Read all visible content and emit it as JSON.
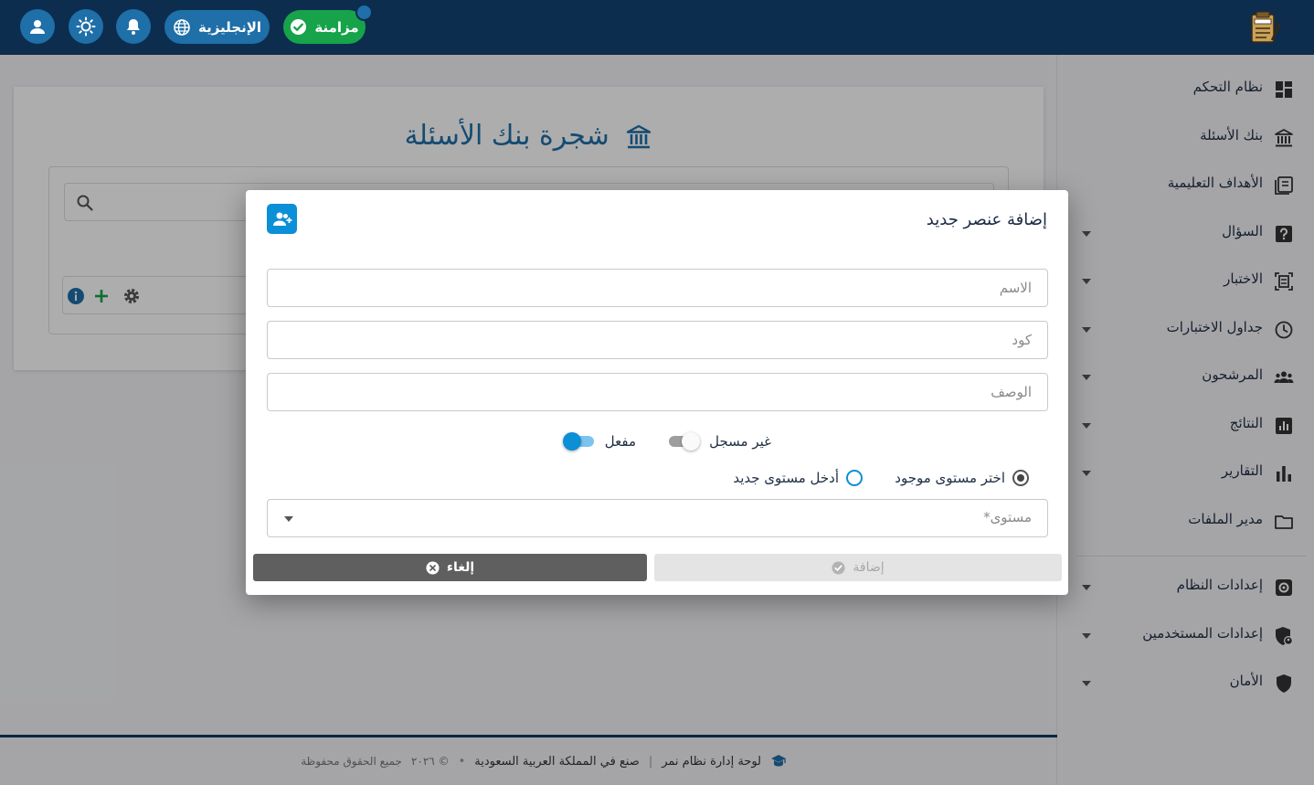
{
  "topbar": {
    "language_label": "الإنجليزية",
    "sync_label": "مزامنة"
  },
  "sidebar": {
    "items": [
      {
        "label": "نظام التحكم"
      },
      {
        "label": "بنك الأسئلة"
      },
      {
        "label": "الأهداف التعليمية"
      },
      {
        "label": "السؤال"
      },
      {
        "label": "الاختبار"
      },
      {
        "label": "جداول الاختبارات"
      },
      {
        "label": "المرشحون"
      },
      {
        "label": "النتائج"
      },
      {
        "label": "التقارير"
      },
      {
        "label": "مدير الملفات"
      },
      {
        "label": "إعدادات النظام"
      },
      {
        "label": "إعدادات المستخدمين"
      },
      {
        "label": "الأمان"
      }
    ]
  },
  "main": {
    "title": "شجرة بنك الأسئلة"
  },
  "dialog": {
    "title": "إضافة عنصر جديد",
    "name_placeholder": "الاسم",
    "code_placeholder": "كود",
    "description_placeholder": "الوصف",
    "toggle_unregistered_label": "غير مسجل",
    "toggle_unregistered_on": false,
    "toggle_enabled_label": "مفعل",
    "toggle_enabled_on": true,
    "radio_existing_label": "اختر مستوى موجود",
    "radio_new_label": "أدخل مستوى جديد",
    "selected_radio": "existing",
    "level_select_label": "مستوى*",
    "add_button": "إضافة",
    "cancel_button": "إلغاء"
  },
  "footer": {
    "brand": "لوحة إدارة نظام نمر",
    "made_in": "صنع في المملكة العربية السعودية",
    "rights": "جميع الحقوق محفوظة",
    "copyright": "© ٢٠٢٦"
  },
  "colors": {
    "topbar": "#0d2d4e",
    "accent": "#1f6fa8",
    "sync_green": "#16a34a",
    "primary_blue": "#0b8fd6"
  }
}
